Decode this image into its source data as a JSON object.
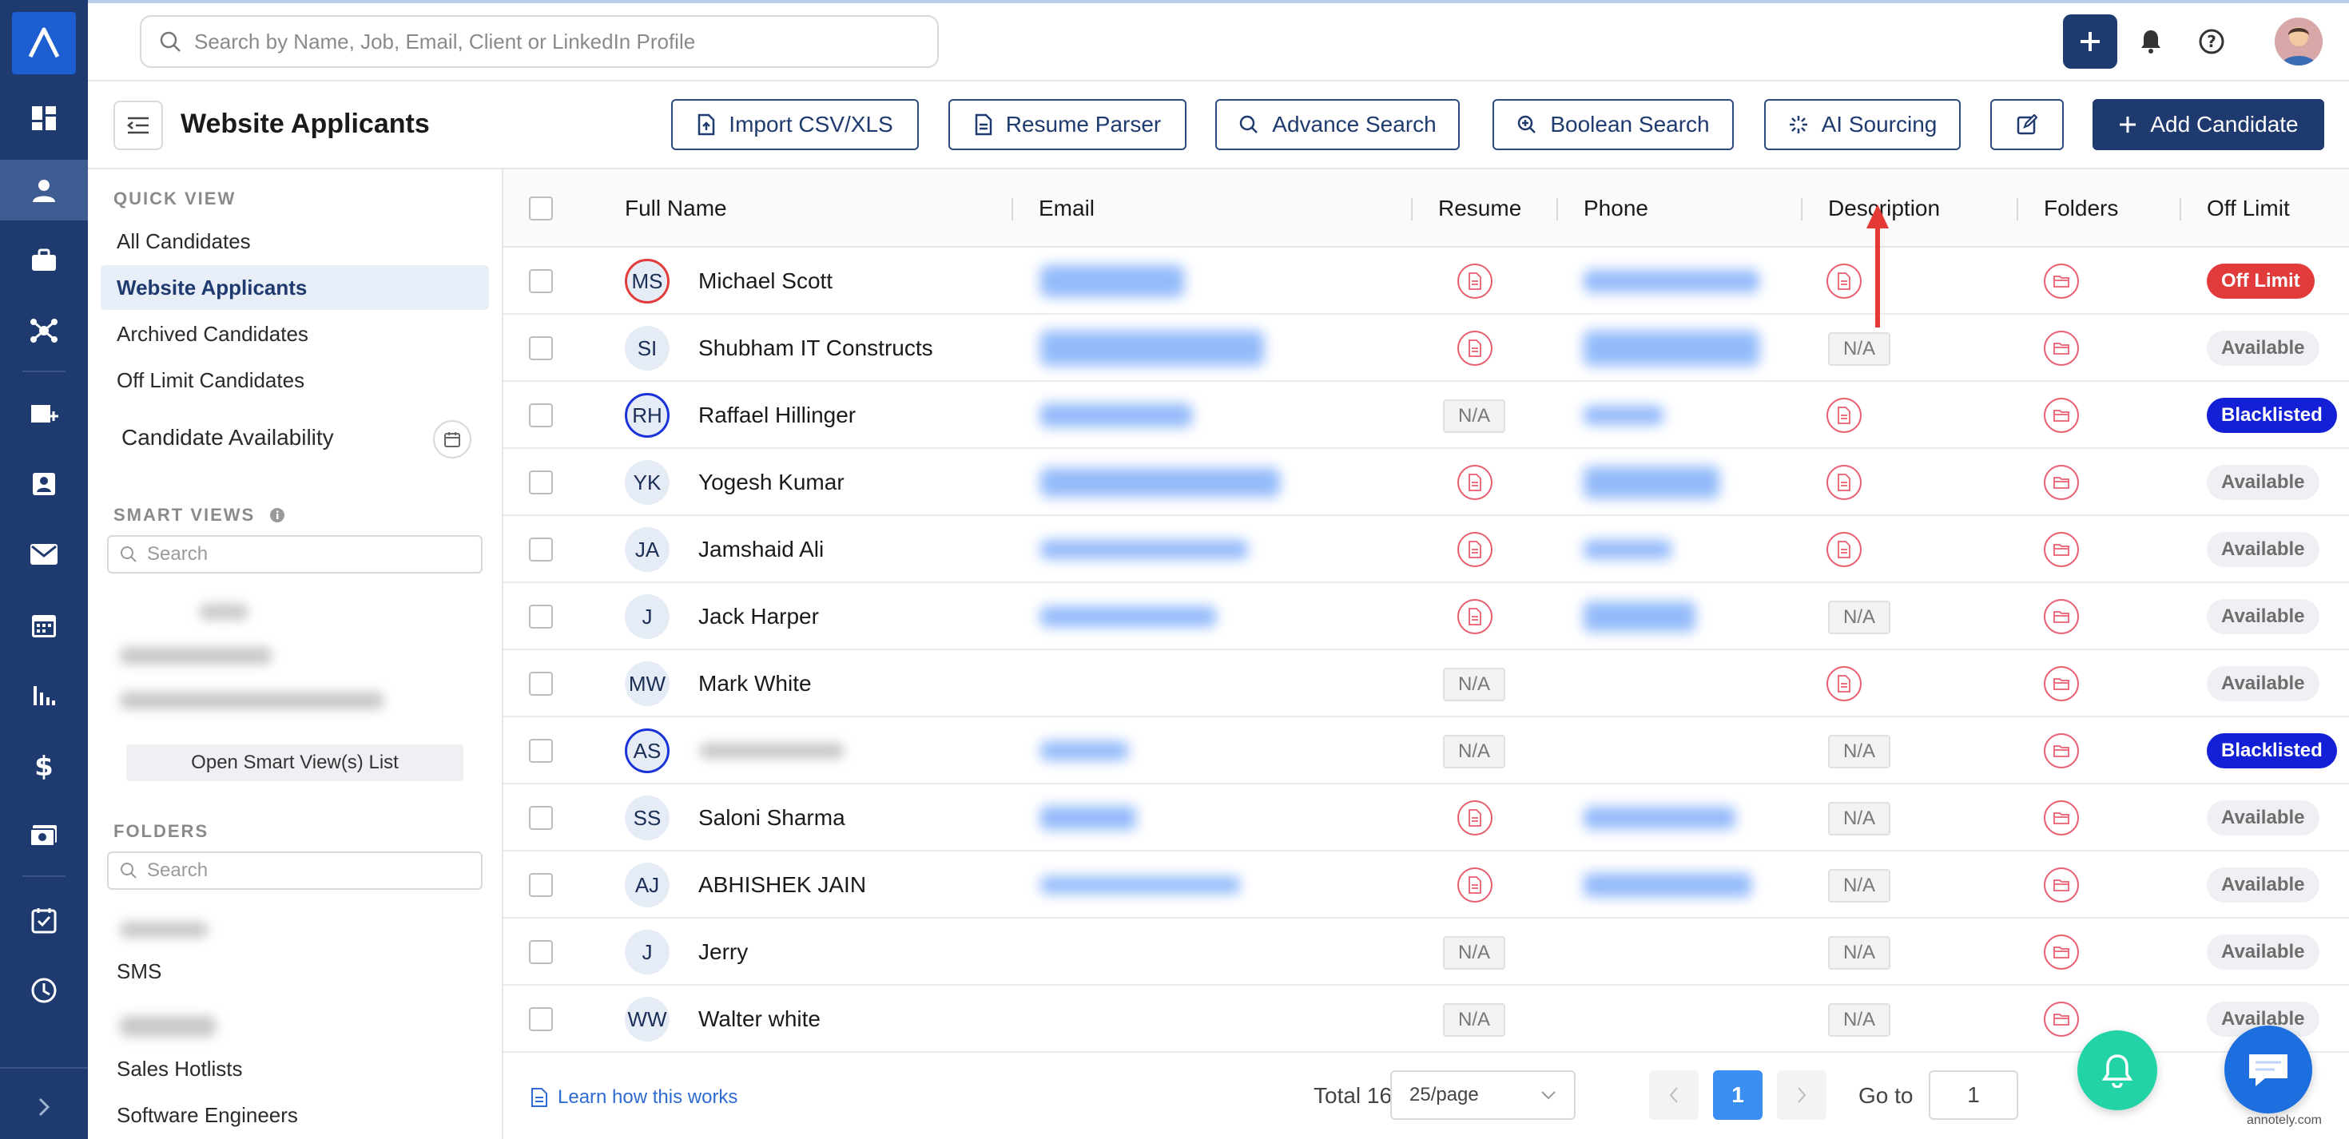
{
  "search": {
    "placeholder": "Search by Name, Job, Email, Client or LinkedIn Profile"
  },
  "page": {
    "title": "Website Applicants"
  },
  "toolbar": {
    "import_label": "Import CSV/XLS",
    "parser_label": "Resume Parser",
    "advance_label": "Advance Search",
    "boolean_label": "Boolean Search",
    "ai_label": "AI Sourcing",
    "add_label": "Add Candidate"
  },
  "sidebar": {
    "quick_view_label": "QUICK VIEW",
    "items": [
      "All Candidates",
      "Website Applicants",
      "Archived Candidates",
      "Off Limit Candidates"
    ],
    "availability_label": "Candidate Availability",
    "smart_views_label": "SMART VIEWS",
    "smart_search_placeholder": "Search",
    "open_smart_label": "Open Smart View(s) List",
    "folders_label": "FOLDERS",
    "folder_search_placeholder": "Search",
    "folders": [
      "SMS",
      "Sales Hotlists",
      "Software Engineers"
    ]
  },
  "table": {
    "columns": [
      "Full Name",
      "Email",
      "Resume",
      "Phone",
      "Description",
      "Folders",
      "Off Limit"
    ],
    "na_label": "N/A",
    "rows": [
      {
        "initials": "MS",
        "name": "Michael Scott",
        "resume": true,
        "description": true,
        "status": "Off Limit"
      },
      {
        "initials": "SI",
        "name": "Shubham IT Constructs",
        "resume": true,
        "description": false,
        "status": "Available"
      },
      {
        "initials": "RH",
        "name": "Raffael Hillinger",
        "resume": false,
        "description": true,
        "status": "Blacklisted"
      },
      {
        "initials": "YK",
        "name": "Yogesh Kumar",
        "resume": true,
        "description": true,
        "status": "Available"
      },
      {
        "initials": "JA",
        "name": "Jamshaid Ali",
        "resume": true,
        "description": true,
        "status": "Available"
      },
      {
        "initials": "J",
        "name": "Jack Harper",
        "resume": true,
        "description": false,
        "status": "Available"
      },
      {
        "initials": "MW",
        "name": "Mark White",
        "resume": false,
        "description": true,
        "status": "Available"
      },
      {
        "initials": "AS",
        "name": "",
        "resume": false,
        "description": false,
        "status": "Blacklisted"
      },
      {
        "initials": "SS",
        "name": "Saloni Sharma",
        "resume": true,
        "description": false,
        "status": "Available"
      },
      {
        "initials": "AJ",
        "name": "ABHISHEK JAIN",
        "resume": true,
        "description": false,
        "status": "Available"
      },
      {
        "initials": "J",
        "name": "Jerry",
        "resume": false,
        "description": false,
        "status": "Available"
      },
      {
        "initials": "WW",
        "name": "Walter white",
        "resume": false,
        "description": false,
        "status": "Available"
      }
    ]
  },
  "footer": {
    "learn_label": "Learn how this works",
    "total_label": "Total 16",
    "page_size": "25/page",
    "current_page": "1",
    "goto_label": "Go to",
    "goto_value": "1"
  },
  "watermark": "annotely.com",
  "colors": {
    "primary": "#1f3a6e",
    "off_limit": "#e13b3b",
    "blacklisted": "#1420d6",
    "fab_bell": "#21d3a6",
    "fab_chat": "#1d6fe0"
  }
}
